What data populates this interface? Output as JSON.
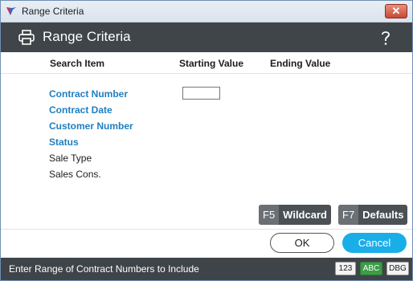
{
  "window": {
    "title": "Range Criteria"
  },
  "header": {
    "title": "Range Criteria"
  },
  "columns": {
    "search_item": "Search Item",
    "starting_value": "Starting Value",
    "ending_value": "Ending Value"
  },
  "fields": [
    {
      "label": "Contract Number",
      "style": "link"
    },
    {
      "label": "Contract Date",
      "style": "link"
    },
    {
      "label": "Customer Number",
      "style": "link"
    },
    {
      "label": "Status",
      "style": "link"
    },
    {
      "label": "Sale Type",
      "style": "plain"
    },
    {
      "label": "Sales Cons.",
      "style": "plain"
    }
  ],
  "inputs": {
    "contract_number_start": ""
  },
  "function_keys": {
    "f5": {
      "key": "F5",
      "label": "Wildcard"
    },
    "f7": {
      "key": "F7",
      "label": "Defaults"
    }
  },
  "buttons": {
    "ok": "OK",
    "cancel": "Cancel"
  },
  "status": {
    "message": "Enter Range of Contract Numbers to Include",
    "badges": [
      "123",
      "ABC",
      "DBG"
    ]
  },
  "colors": {
    "header_bg": "#404549",
    "link_label": "#1f7fbf",
    "cancel_bg": "#1aaee8",
    "abc_badge": "#3c9c47"
  },
  "icons": [
    "app-logo-icon",
    "close-icon",
    "printer-icon",
    "help-icon"
  ]
}
